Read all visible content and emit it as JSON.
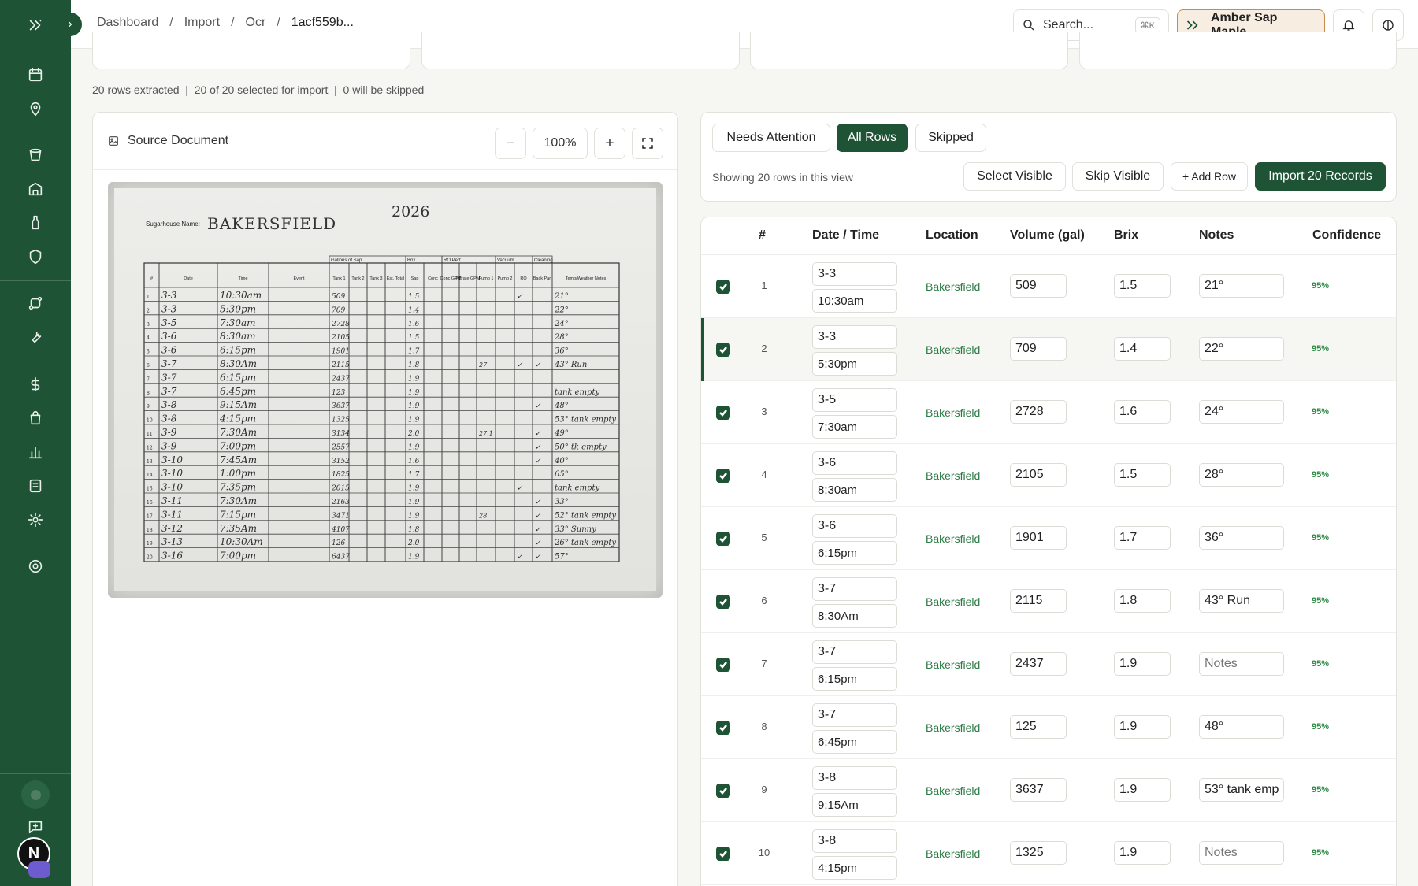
{
  "breadcrumb": [
    "Dashboard",
    "Import",
    "Ocr",
    "1acf559b..."
  ],
  "search": {
    "placeholder": "Search...",
    "shortcut": "⌘K"
  },
  "user": {
    "name": "Amber Sap Maple"
  },
  "summary": "20 rows extracted  |  20 of 20 selected for import  |  0 will be skipped",
  "source": {
    "title": "Source Document",
    "zoom": "100%",
    "zoom_out": "−",
    "zoom_in": "+"
  },
  "document": {
    "sugarhouse_label": "Sugarhouse Name:",
    "sugarhouse_value": "BAKERSFIELD",
    "year": "2026",
    "group_headers": [
      "Gallons of Sap",
      "Brix",
      "RO Perf.",
      "Vacuum",
      "Cleaning"
    ],
    "columns": [
      "#",
      "Date",
      "Time",
      "Event",
      "Tank 1",
      "Tank 2",
      "Tank 3",
      "Est. Total",
      "Sap",
      "Conc",
      "Conc GPM",
      "Filtrate GPM",
      "Pump 1",
      "Pump 2",
      "RO",
      "Back Pan",
      "Temp/Weather Notes"
    ],
    "rows": [
      [
        "1",
        "3-3",
        "10:30am",
        "",
        "509",
        "",
        "",
        "",
        "1.5",
        "",
        "",
        "",
        "",
        "",
        "✓",
        "",
        "21°"
      ],
      [
        "2",
        "3-3",
        "5:30pm",
        "",
        "709",
        "",
        "",
        "",
        "1.4",
        "",
        "",
        "",
        "",
        "",
        "",
        "",
        "22°"
      ],
      [
        "3",
        "3-5",
        "7:30am",
        "",
        "2728",
        "",
        "",
        "",
        "1.6",
        "",
        "",
        "",
        "",
        "",
        "",
        "",
        "24°"
      ],
      [
        "4",
        "3-6",
        "8:30am",
        "",
        "2105",
        "",
        "",
        "",
        "1.5",
        "",
        "",
        "",
        "",
        "",
        "",
        "",
        "28°"
      ],
      [
        "5",
        "3-6",
        "6:15pm",
        "",
        "1901",
        "",
        "",
        "",
        "1.7",
        "",
        "",
        "",
        "",
        "",
        "",
        "",
        "36°"
      ],
      [
        "6",
        "3-7",
        "8:30Am",
        "",
        "2115",
        "",
        "",
        "",
        "1.8",
        "",
        "",
        "",
        "27",
        "",
        "✓",
        "✓",
        "43° Run"
      ],
      [
        "7",
        "3-7",
        "6:15pm",
        "",
        "2437",
        "",
        "",
        "",
        "1.9",
        "",
        "",
        "",
        "",
        "",
        "",
        "",
        ""
      ],
      [
        "8",
        "3-7",
        "6:45pm",
        "",
        "123",
        "",
        "",
        "",
        "1.9",
        "",
        "",
        "",
        "",
        "",
        "",
        "",
        "tank empty"
      ],
      [
        "9",
        "3-8",
        "9:15Am",
        "",
        "3637",
        "",
        "",
        "",
        "1.9",
        "",
        "",
        "",
        "",
        "",
        "",
        "✓",
        "48°"
      ],
      [
        "10",
        "3-8",
        "4:15pm",
        "",
        "1325",
        "",
        "",
        "",
        "1.9",
        "",
        "",
        "",
        "",
        "",
        "",
        "",
        "53° tank empty"
      ],
      [
        "11",
        "3-9",
        "7:30Am",
        "",
        "3134",
        "",
        "",
        "",
        "2.0",
        "",
        "",
        "",
        "27.1",
        "",
        "",
        "✓",
        "49°"
      ],
      [
        "12",
        "3-9",
        "7:00pm",
        "",
        "2557",
        "",
        "",
        "",
        "1.9",
        "",
        "",
        "",
        "",
        "",
        "",
        "✓",
        "50° tk empty"
      ],
      [
        "13",
        "3-10",
        "7:45Am",
        "",
        "3152",
        "",
        "",
        "",
        "1.6",
        "",
        "",
        "",
        "",
        "",
        "",
        "✓",
        "40°"
      ],
      [
        "14",
        "3-10",
        "1:00pm",
        "",
        "1825",
        "",
        "",
        "",
        "1.7",
        "",
        "",
        "",
        "",
        "",
        "",
        "",
        "65°"
      ],
      [
        "15",
        "3-10",
        "7:35pm",
        "",
        "2015",
        "",
        "",
        "",
        "1.9",
        "",
        "",
        "",
        "",
        "",
        "✓",
        "",
        "tank empty"
      ],
      [
        "16",
        "3-11",
        "7:30Am",
        "",
        "2163",
        "",
        "",
        "",
        "1.9",
        "",
        "",
        "",
        "",
        "",
        "",
        "✓",
        "33°"
      ],
      [
        "17",
        "3-11",
        "7:15pm",
        "",
        "3471",
        "",
        "",
        "",
        "1.9",
        "",
        "",
        "",
        "28",
        "",
        "",
        "✓",
        "52° tank empty"
      ],
      [
        "18",
        "3-12",
        "7:35Am",
        "",
        "4107",
        "",
        "",
        "",
        "1.8",
        "",
        "",
        "",
        "",
        "",
        "",
        "✓",
        "33° Sunny"
      ],
      [
        "19",
        "3-13",
        "10:30Am",
        "",
        "126",
        "",
        "",
        "",
        "2.0",
        "",
        "",
        "",
        "",
        "",
        "",
        "✓",
        "26° tank empty"
      ],
      [
        "20",
        "3-16",
        "7:00pm",
        "",
        "6437",
        "",
        "",
        "",
        "1.9",
        "",
        "",
        "",
        "",
        "",
        "✓",
        "✓",
        "57°"
      ]
    ]
  },
  "tabs": [
    "Needs Attention",
    "All Rows",
    "Skipped"
  ],
  "showing": "Showing 20 rows in this view",
  "actions": {
    "select_visible": "Select Visible",
    "skip_visible": "Skip Visible",
    "add_row": "+ Add Row",
    "import": "Import 20 Records"
  },
  "table": {
    "headers": [
      "#",
      "Date / Time",
      "Location",
      "Volume (gal)",
      "Brix",
      "Notes",
      "Confidence"
    ],
    "notes_placeholder": "Notes",
    "rows": [
      {
        "n": "1",
        "date": "3-3",
        "time": "10:30am",
        "loc": "Bakersfield",
        "vol": "509",
        "brix": "1.5",
        "notes": "21°",
        "conf": "95%"
      },
      {
        "n": "2",
        "date": "3-3",
        "time": "5:30pm",
        "loc": "Bakersfield",
        "vol": "709",
        "brix": "1.4",
        "notes": "22°",
        "conf": "95%"
      },
      {
        "n": "3",
        "date": "3-5",
        "time": "7:30am",
        "loc": "Bakersfield",
        "vol": "2728",
        "brix": "1.6",
        "notes": "24°",
        "conf": "95%"
      },
      {
        "n": "4",
        "date": "3-6",
        "time": "8:30am",
        "loc": "Bakersfield",
        "vol": "2105",
        "brix": "1.5",
        "notes": "28°",
        "conf": "95%"
      },
      {
        "n": "5",
        "date": "3-6",
        "time": "6:15pm",
        "loc": "Bakersfield",
        "vol": "1901",
        "brix": "1.7",
        "notes": "36°",
        "conf": "95%"
      },
      {
        "n": "6",
        "date": "3-7",
        "time": "8:30Am",
        "loc": "Bakersfield",
        "vol": "2115",
        "brix": "1.8",
        "notes": "43° Run",
        "conf": "95%"
      },
      {
        "n": "7",
        "date": "3-7",
        "time": "6:15pm",
        "loc": "Bakersfield",
        "vol": "2437",
        "brix": "1.9",
        "notes": "",
        "conf": "95%"
      },
      {
        "n": "8",
        "date": "3-7",
        "time": "6:45pm",
        "loc": "Bakersfield",
        "vol": "125",
        "brix": "1.9",
        "notes": "48°",
        "conf": "95%"
      },
      {
        "n": "9",
        "date": "3-8",
        "time": "9:15Am",
        "loc": "Bakersfield",
        "vol": "3637",
        "brix": "1.9",
        "notes": "53° tank emp",
        "conf": "95%"
      },
      {
        "n": "10",
        "date": "3-8",
        "time": "4:15pm",
        "loc": "Bakersfield",
        "vol": "1325",
        "brix": "1.9",
        "notes": "",
        "conf": "95%"
      }
    ]
  },
  "colors": {
    "primary": "#1e5335",
    "accent_green": "#2c7a45",
    "user_chip_border": "#c98a4a"
  },
  "sidebar_icons": [
    "collapse-icon",
    "calendar-icon",
    "location-pin-icon",
    "bucket-icon",
    "building-icon",
    "bottle-icon",
    "shield-icon",
    "route-icon",
    "wrench-icon",
    "dollar-icon",
    "bag-icon",
    "bar-chart-icon",
    "receipt-icon",
    "gear-badge-icon",
    "settings-icon",
    "feedback-icon"
  ]
}
